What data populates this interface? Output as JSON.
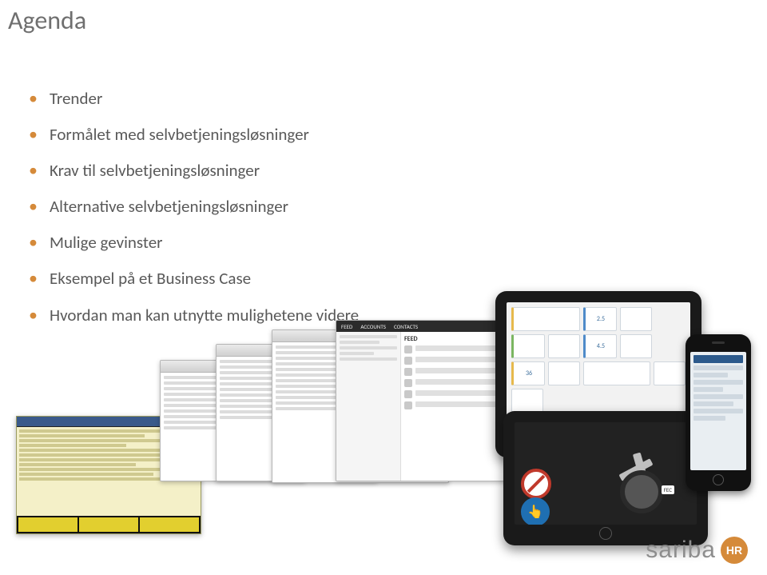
{
  "title": "Agenda",
  "agenda": [
    "Trender",
    "Formålet med selvbetjeningsløsninger",
    "Krav til selvbetjeningsløsninger",
    "Alternative selvbetjeningsløsninger",
    "Mulige gevinster",
    "Eksempel på et Business Case",
    "Hvordan man kan utnytte mulighetene videre"
  ],
  "feed": {
    "nav0": "FEED",
    "nav1": "ACCOUNTS",
    "nav2": "CONTACTS",
    "heading": "FEED"
  },
  "tiles": {
    "a": "2.5",
    "b": "4.5",
    "c": "36"
  },
  "tablet_dark": {
    "label": "FEC",
    "hand_icon": "👆"
  },
  "logo": {
    "word": "sariba",
    "badge": "HR"
  }
}
